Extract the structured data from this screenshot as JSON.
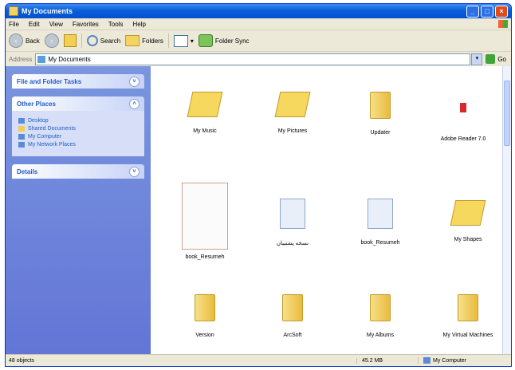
{
  "window": {
    "title": "My Documents"
  },
  "menu": [
    "File",
    "Edit",
    "View",
    "Favorites",
    "Tools",
    "Help"
  ],
  "toolbar": {
    "back": "Back",
    "search": "Search",
    "folders": "Folders",
    "folder_sync": "Folder Sync"
  },
  "address": {
    "label": "Address",
    "path": "My Documents",
    "go": "Go"
  },
  "taskpane": {
    "panels": [
      {
        "title": "File and Folder Tasks"
      },
      {
        "title": "Other Places",
        "items": [
          "Desktop",
          "Shared Documents",
          "My Computer",
          "My Network Places"
        ]
      },
      {
        "title": "Details"
      }
    ]
  },
  "files": [
    {
      "name": "My Music",
      "icon": "music-folder-icon"
    },
    {
      "name": "My Pictures",
      "icon": "pictures-folder-icon"
    },
    {
      "name": "Updater",
      "icon": "folder-icon"
    },
    {
      "name": "Adobe Reader 7.0",
      "icon": "adobe-icon"
    },
    {
      "name": "book_Resumeh",
      "icon": "document-thumbnail"
    },
    {
      "name": "نسخه پشتیبان",
      "icon": "document-icon"
    },
    {
      "name": "book_Resumeh",
      "icon": "document-icon"
    },
    {
      "name": "My Shapes",
      "icon": "shapes-folder-icon"
    },
    {
      "name": "Version",
      "icon": "folder-icon"
    },
    {
      "name": "ArcSoft",
      "icon": "folder-icon"
    },
    {
      "name": "My Albums",
      "icon": "folder-icon"
    },
    {
      "name": "My Virtual Machines",
      "icon": "folder-icon"
    }
  ],
  "status": {
    "objects": "48 objects",
    "size": "45.2 MB",
    "location": "My Computer"
  }
}
